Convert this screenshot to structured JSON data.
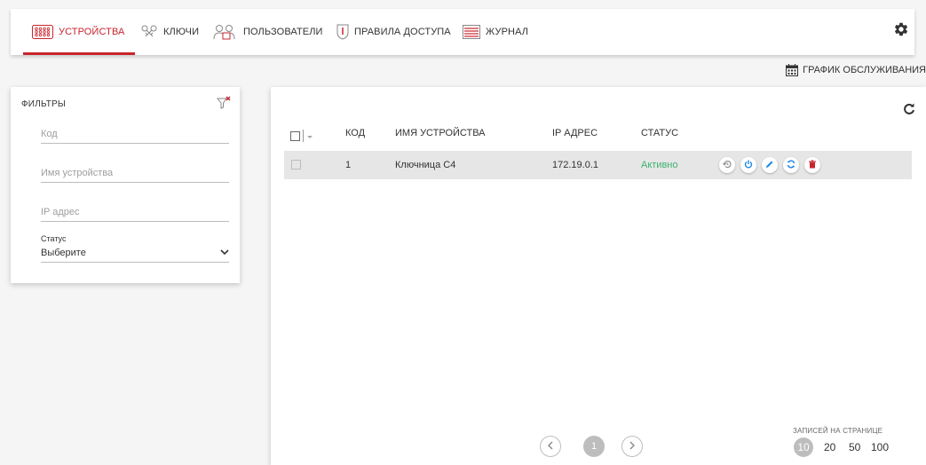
{
  "nav": {
    "tabs": [
      {
        "label": "УСТРОЙСТВА",
        "icon": "devices-grid-icon",
        "active": true
      },
      {
        "label": "КЛЮЧИ",
        "icon": "keys-icon",
        "active": false
      },
      {
        "label": "ПОЛЬЗОВАТЕЛИ",
        "icon": "users-icon",
        "active": false
      },
      {
        "label": "ПРАВИЛА ДОСТУПА",
        "icon": "shield-icon",
        "active": false
      },
      {
        "label": "ЖУРНАЛ",
        "icon": "journal-icon",
        "active": false
      }
    ],
    "settings_icon": "gear-icon",
    "accent_color": "#c8252c"
  },
  "schedule_label": "ГРАФИК ОБСЛУЖИВАНИЯ",
  "filters": {
    "title": "ФИЛЬТРЫ",
    "code_placeholder": "Код",
    "name_placeholder": "Имя устройства",
    "ip_placeholder": "IP адрес",
    "status_label": "Статус",
    "status_value": "Выберите"
  },
  "table": {
    "columns": [
      "КОД",
      "ИМЯ УСТРОЙСТВА",
      "IP АДРЕС",
      "СТАТУС"
    ],
    "rows": [
      {
        "code": "1",
        "name": "Ключница С4",
        "ip": "172.19.0.1",
        "status": "Активно",
        "status_color": "#3cb371"
      }
    ]
  },
  "pagination": {
    "current_page": "1",
    "per_page_label": "ЗАПИСЕЙ НА СТРАНИЦЕ",
    "per_page_options": [
      "10",
      "20",
      "50",
      "100"
    ],
    "per_page_selected": "10"
  }
}
